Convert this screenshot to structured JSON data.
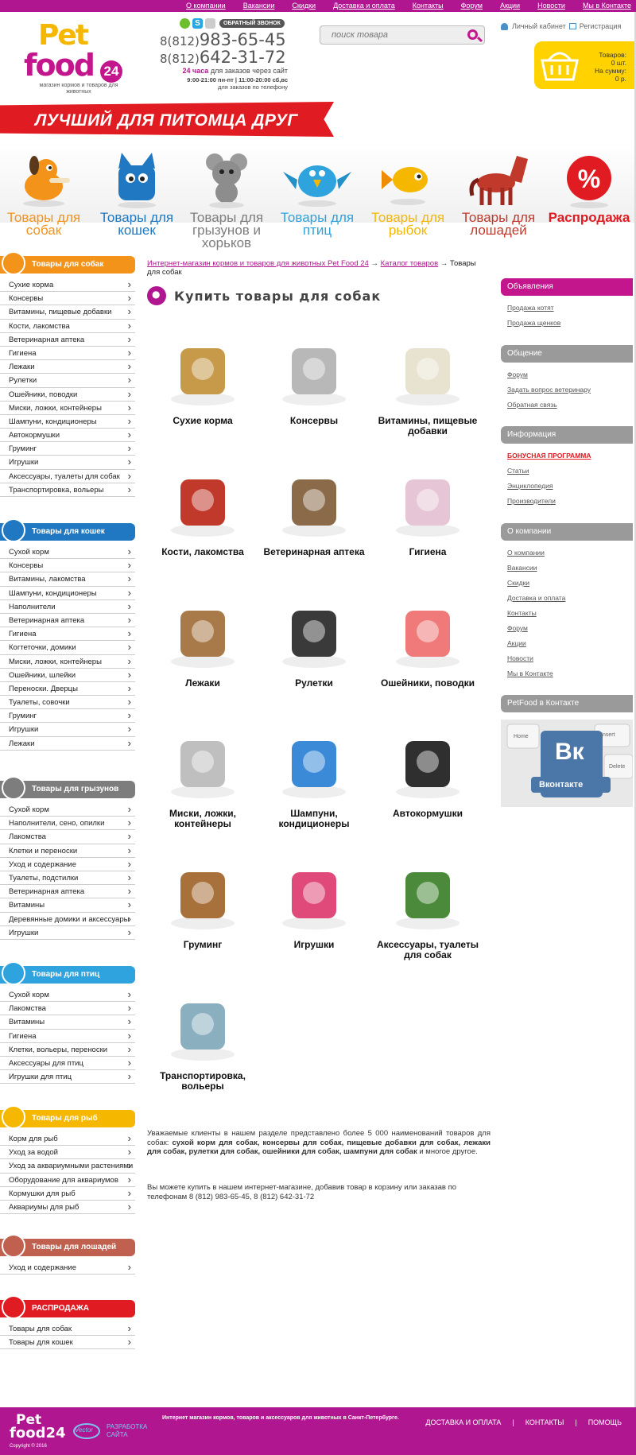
{
  "topnav": [
    "О компании",
    "Вакансии",
    "Скидки",
    "Доставка и оплата",
    "Контакты",
    "Форум",
    "Акции",
    "Новости",
    "Мы в Контакте"
  ],
  "logo": {
    "line1": "Pet",
    "line2": "food",
    "badge": "24",
    "tagline": "магазин кормов и товаров для животных"
  },
  "header": {
    "callback": "ОБРАТНЫЙ ЗВОНОК",
    "phone1_code": "8(812)",
    "phone1": "983-65-45",
    "phone2_code": "8(812)",
    "phone2": "642-31-72",
    "hours_bold": "24 часа",
    "hours_text": "для заказов через сайт",
    "hours_line2": "9:00-21:00 пн-пт | 11:00-20:00 сб,вс",
    "hours_line3": "для заказов по телефону",
    "search_placeholder": "поиск товара",
    "account": "Личный кабинет",
    "register": "Регистрация",
    "cart_items_label": "Товаров:",
    "cart_items": "0 шт.",
    "cart_sum_label": "На сумму:",
    "cart_sum": "0 р."
  },
  "banner": "ЛУЧШИЙ ДЛЯ ПИТОМЦА ДРУГ",
  "categories": [
    {
      "label": "Товары для собак",
      "color": "#f39319"
    },
    {
      "label": "Товары для кошек",
      "color": "#1f78c1"
    },
    {
      "label": "Товары для грызунов и хорьков",
      "color": "#7d7d7d"
    },
    {
      "label": "Товары для птиц",
      "color": "#2ea3de"
    },
    {
      "label": "Товары для рыбок",
      "color": "#f5b700"
    },
    {
      "label": "Товары для лошадей",
      "color": "#c0392b"
    },
    {
      "label": "Распродажа",
      "color": "#e11b22"
    }
  ],
  "sidebar": {
    "dogs": {
      "title": "Товары для собак",
      "color": "#f39319",
      "items": [
        "Сухие корма",
        "Консервы",
        "Витамины, пищевые добавки",
        "Кости, лакомства",
        "Ветеринарная аптека",
        "Гигиена",
        "Лежаки",
        "Рулетки",
        "Ошейники, поводки",
        "Миски, ложки, контейнеры",
        "Шампуни, кондиционеры",
        "Автокормушки",
        "Груминг",
        "Игрушки",
        "Аксессуары, туалеты для собак",
        "Транспортировка, вольеры"
      ]
    },
    "cats": {
      "title": "Товары для кошек",
      "color": "#1f78c1",
      "items": [
        "Сухой корм",
        "Консервы",
        "Витамины, лакомства",
        "Шампуни, кондиционеры",
        "Наполнители",
        "Ветеринарная аптека",
        "Гигиена",
        "Когтеточки, домики",
        "Миски, ложки, контейнеры",
        "Ошейники, шлейки",
        "Переноски. Дверцы",
        "Туалеты, совочки",
        "Груминг",
        "Игрушки",
        "Лежаки"
      ]
    },
    "rodents": {
      "title": "Товары для грызунов",
      "color": "#7d7d7d",
      "items": [
        "Сухой корм",
        "Наполнители, сено, опилки",
        "Лакомства",
        "Клетки и переноски",
        "Уход и содержание",
        "Туалеты, подстилки",
        "Ветеринарная аптека",
        "Витамины",
        "Деревянные домики и аксессуары",
        "Игрушки"
      ]
    },
    "birds": {
      "title": "Товары для птиц",
      "color": "#2ea3de",
      "items": [
        "Сухой корм",
        "Лакомства",
        "Витамины",
        "Гигиена",
        "Клетки, вольеры, переноски",
        "Аксессуары для птиц",
        "Игрушки для птиц"
      ]
    },
    "fish": {
      "title": "Товары для рыб",
      "color": "#f5b700",
      "items": [
        "Корм для рыб",
        "Уход за водой",
        "Уход за аквариумными растениями",
        "Оборудование для аквариумов",
        "Кормушки для рыб",
        "Аквариумы для рыб"
      ]
    },
    "horses": {
      "title": "Товары для лошадей",
      "color": "#c0614f",
      "items": [
        "Уход и содержание"
      ]
    },
    "sale": {
      "title": "РАСПРОДАЖА",
      "color": "#e11b22",
      "items": [
        "Товары для собак",
        "Товары для кошек"
      ]
    }
  },
  "breadcrumbs": {
    "home": "Интернет-магазин кормов и товаров для животных Pet Food 24",
    "arrow": "→",
    "catalog": "Каталог товаров",
    "current": "Товары для собак"
  },
  "page_title": "Купить товары для собак",
  "products": [
    "Сухие корма",
    "Консервы",
    "Витамины, пищевые добавки",
    "Кости, лакомства",
    "Ветеринарная аптека",
    "Гигиена",
    "Лежаки",
    "Рулетки",
    "Ошейники, поводки",
    "Миски, ложки, контейнеры",
    "Шампуни, кондиционеры",
    "Автокормушки",
    "Груминг",
    "Игрушки",
    "Аксессуары, туалеты для собак",
    "Транспортировка, вольеры"
  ],
  "description": {
    "p1_a": "Уважаемые клиенты в нашем разделе представлено более 5 000 наименований товаров для собак: ",
    "p1_bold": "сухой корм для собак, консервы для собак, пищевые добавки для собак, лежаки для собак, рулетки для собак, ошейники для собак, шампуни для собак",
    "p1_b": " и многое другое.",
    "p2": "Вы можете купить в нашем интернет-магазине, добавив товар в корзину или заказав по телефонам 8 (812) 983-65-45, 8 (812) 642-31-72"
  },
  "right": {
    "ads": {
      "title": "Объявления",
      "color": "#c4168c",
      "links": [
        "Продажа котят",
        "Продажа щенков"
      ]
    },
    "talk": {
      "title": "Общение",
      "color": "#9a9a9a",
      "links": [
        "Форум",
        "Задать вопрос ветеринару",
        "Обратная связь"
      ]
    },
    "info": {
      "title": "Информация",
      "color": "#9a9a9a",
      "links": [
        "БОНУСНАЯ ПРОГРАММА",
        "Статьи",
        "Энциклопедия",
        "Производители"
      ]
    },
    "company": {
      "title": "О компании",
      "color": "#9a9a9a",
      "links": [
        "О компании",
        "Вакансии",
        "Скидки",
        "Доставка и оплата",
        "Контакты",
        "Форум",
        "Акции",
        "Новости",
        "Мы в Контакте"
      ]
    },
    "vk": {
      "title": "PetFood в Контакте",
      "color": "#9a9a9a",
      "badge_big": "Вк",
      "badge_small": "Вконтакте",
      "keys": [
        "Insert",
        "Delete",
        "Home"
      ]
    }
  },
  "footer": {
    "logo1": "Pet",
    "logo2": "food24",
    "copyright": "Copyright © 2016",
    "dev1": "РАЗРАБОТКА",
    "dev2": "САЙТА",
    "dev_brand": "Vector",
    "about": "Интернет магазин кормов, товаров и аксессуаров для животных в Санкт-Петербурге.",
    "links": [
      "ДОСТАВКА И ОПЛАТА",
      "КОНТАКТЫ",
      "ПОМОЩЬ"
    ],
    "sep": "|"
  }
}
